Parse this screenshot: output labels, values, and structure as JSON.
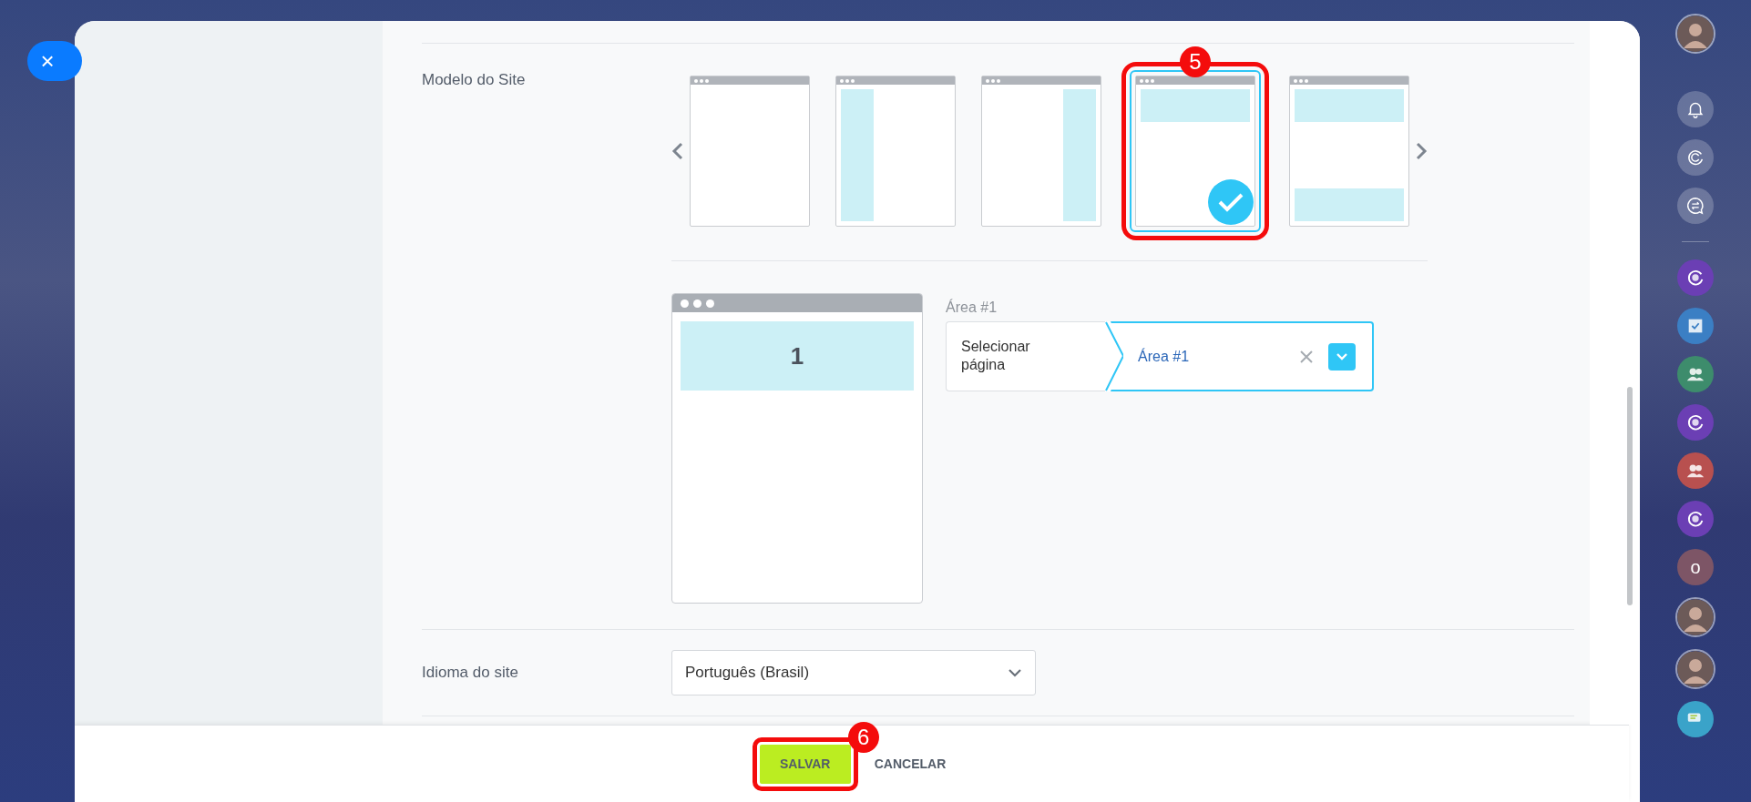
{
  "close_button": {
    "label": "×"
  },
  "site_template": {
    "label": "Modelo do Site",
    "templates": [
      {
        "kind": "blank",
        "selected": false
      },
      {
        "kind": "left-column",
        "selected": false
      },
      {
        "kind": "right-column",
        "selected": false
      },
      {
        "kind": "header",
        "selected": true,
        "annotation": "5"
      },
      {
        "kind": "header-footer",
        "selected": false
      }
    ],
    "preview": {
      "area_number": "1"
    },
    "area": {
      "label": "Área #1",
      "page_label": "Selecionar página",
      "value": "Área #1"
    }
  },
  "language": {
    "label": "Idioma do site",
    "value": "Português (Brasil)"
  },
  "footer": {
    "save": {
      "label": "SALVAR",
      "annotation": "6"
    },
    "cancel": {
      "label": "CANCELAR"
    }
  },
  "right_sidebar": [
    {
      "kind": "avatar"
    },
    {
      "kind": "bell"
    },
    {
      "kind": "sync"
    },
    {
      "kind": "chat-swap"
    },
    {
      "kind": "divider"
    },
    {
      "kind": "app",
      "color": "#6b3fb4"
    },
    {
      "kind": "task",
      "color": "#3b7fc4"
    },
    {
      "kind": "group",
      "color": "#3d8c6c"
    },
    {
      "kind": "app",
      "color": "#6b3fb4"
    },
    {
      "kind": "group",
      "color": "#b8504f"
    },
    {
      "kind": "app",
      "color": "#6b3fb4"
    },
    {
      "kind": "letter",
      "color": "#7d5566",
      "text": "o"
    },
    {
      "kind": "avatar"
    },
    {
      "kind": "avatar"
    },
    {
      "kind": "chat",
      "color": "#3aa3c9"
    }
  ]
}
